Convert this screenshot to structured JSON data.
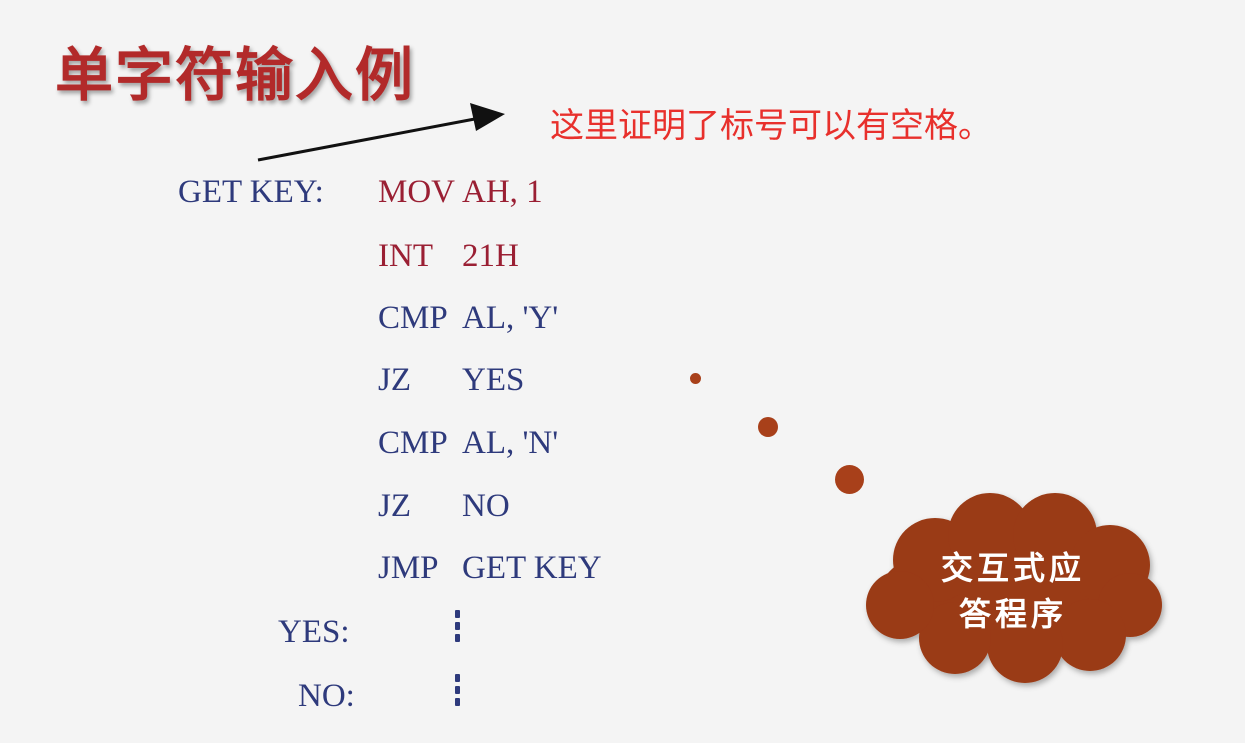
{
  "title": "单字符输入例",
  "note": "这里证明了标号可以有空格。",
  "code": {
    "label_getkey": "GET KEY:",
    "lines": [
      {
        "op": "MOV",
        "args": "AH, 1"
      },
      {
        "op": "INT",
        "args": "21H"
      },
      {
        "op": "CMP",
        "args": "AL, 'Y'"
      },
      {
        "op": "JZ",
        "args": "YES"
      },
      {
        "op": "CMP",
        "args": "AL, 'N'"
      },
      {
        "op": "JZ",
        "args": "NO"
      },
      {
        "op": "JMP",
        "args": "GET KEY"
      }
    ],
    "label_yes": "YES:",
    "label_no": "NO:"
  },
  "cloud": {
    "line1": "交互式应",
    "line2": "答程序",
    "color": "#9a3a14"
  },
  "colors": {
    "title": "#b22a2a",
    "note": "#e8302c",
    "code": "#2e3a7c",
    "code_red": "#9a1f33"
  }
}
